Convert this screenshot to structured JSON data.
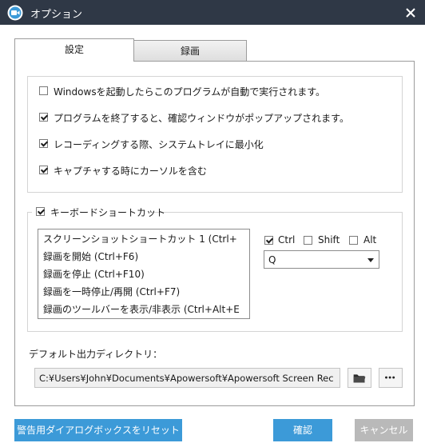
{
  "window": {
    "title": "オプション"
  },
  "tabs": [
    {
      "label": "設定",
      "active": true
    },
    {
      "label": "録画",
      "active": false
    }
  ],
  "general_options": [
    {
      "label": "Windowsを起動したらこのプログラムが自動で実行されます。",
      "checked": false
    },
    {
      "label": "プログラムを終了すると、確認ウィンドウがポップアップされます。",
      "checked": true
    },
    {
      "label": "レコーディングする際、システムトレイに最小化",
      "checked": true
    },
    {
      "label": "キャプチャする時にカーソルを含む",
      "checked": true
    }
  ],
  "hotkeys": {
    "legend": "キーボードショートカット",
    "enabled": true,
    "items": [
      "スクリーンショットショートカット 1 (Ctrl+",
      "録画を開始 (Ctrl+F6)",
      "録画を停止 (Ctrl+F10)",
      "録画を一時停止/再開 (Ctrl+F7)",
      "録画のツールバーを表示/非表示 (Ctrl+Alt+E"
    ],
    "modifiers": [
      {
        "label": "Ctrl",
        "checked": true
      },
      {
        "label": "Shift",
        "checked": false
      },
      {
        "label": "Alt",
        "checked": false
      }
    ],
    "key_value": "Q"
  },
  "output": {
    "label": "デフォルト出力ディレクトリ：",
    "path": "C:¥Users¥John¥Documents¥Apowersoft¥Apowersoft Screen Rec",
    "browse_icon": "folder-icon",
    "more_icon": "ellipsis-icon"
  },
  "footer": {
    "reset_label": "警告用ダイアログボックスをリセット",
    "ok_label": "確認",
    "cancel_label": "キャンセル"
  },
  "colors": {
    "titlebar": "#2f3846",
    "accent": "#3c9ad8",
    "disabled": "#b9b9b9"
  }
}
